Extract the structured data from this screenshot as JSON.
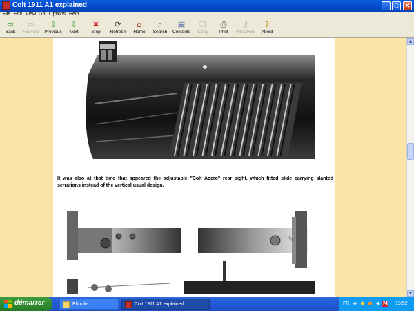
{
  "window": {
    "title": "Colt 1911 A1 explained",
    "controls": {
      "minimize": "_",
      "maximize": "□",
      "close": "✕"
    }
  },
  "menu": [
    "File",
    "Edit",
    "View",
    "Go",
    "Options",
    "Help"
  ],
  "toolbar": [
    {
      "label": "Back",
      "icon": "back-arrow-icon",
      "glyph": "⇦",
      "color": "#2f9a2f",
      "enabled": true
    },
    {
      "label": "Forward",
      "icon": "forward-arrow-icon",
      "glyph": "⇨",
      "color": "#b8b5a4",
      "enabled": false
    },
    {
      "label": "Previous",
      "icon": "up-arrow-icon",
      "glyph": "⇧",
      "color": "#2f9a2f",
      "enabled": true
    },
    {
      "label": "Next",
      "icon": "down-arrow-icon",
      "glyph": "⇩",
      "color": "#2f9a2f",
      "enabled": true
    },
    {
      "label": "Stop",
      "icon": "stop-icon",
      "glyph": "✖",
      "color": "#d02020",
      "enabled": true
    },
    {
      "label": "Refresh",
      "icon": "refresh-icon",
      "glyph": "⟳",
      "color": "#3a3a3a",
      "enabled": true
    },
    {
      "label": "Home",
      "icon": "home-icon",
      "glyph": "⌂",
      "color": "#a0522d",
      "enabled": true
    },
    {
      "label": "Search",
      "icon": "search-icon",
      "glyph": "⌕",
      "color": "#3a5a9a",
      "enabled": true
    },
    {
      "label": "Contents",
      "icon": "contents-icon",
      "glyph": "▤",
      "color": "#3a5a9a",
      "enabled": true
    },
    {
      "label": "Copy",
      "icon": "copy-icon",
      "glyph": "❐",
      "color": "#b8b5a4",
      "enabled": false
    },
    {
      "label": "Print",
      "icon": "print-icon",
      "glyph": "⎙",
      "color": "#3a3a3a",
      "enabled": true
    },
    {
      "label": "Password",
      "icon": "key-icon",
      "glyph": "⚷",
      "color": "#b8b5a4",
      "enabled": false
    },
    {
      "label": "About",
      "icon": "help-icon",
      "glyph": "?",
      "color": "#b8860b",
      "enabled": true
    }
  ],
  "page": {
    "paragraph": "It was also at that time that appeared the adjustable \"Colt Accro\" rear sight, which fitted slide carrying slanted serrations instead of the vertical usual design.",
    "figure2_marking": "UP"
  },
  "taskbar": {
    "start_label": "démarrer",
    "tasks": [
      {
        "label": "Ebooks",
        "icon": "folder-icon",
        "active": false
      },
      {
        "label": "Colt 1911 A1 explained",
        "icon": "ebook-icon",
        "active": true
      }
    ],
    "tray": {
      "language": "FR",
      "clock": "13:52"
    }
  }
}
